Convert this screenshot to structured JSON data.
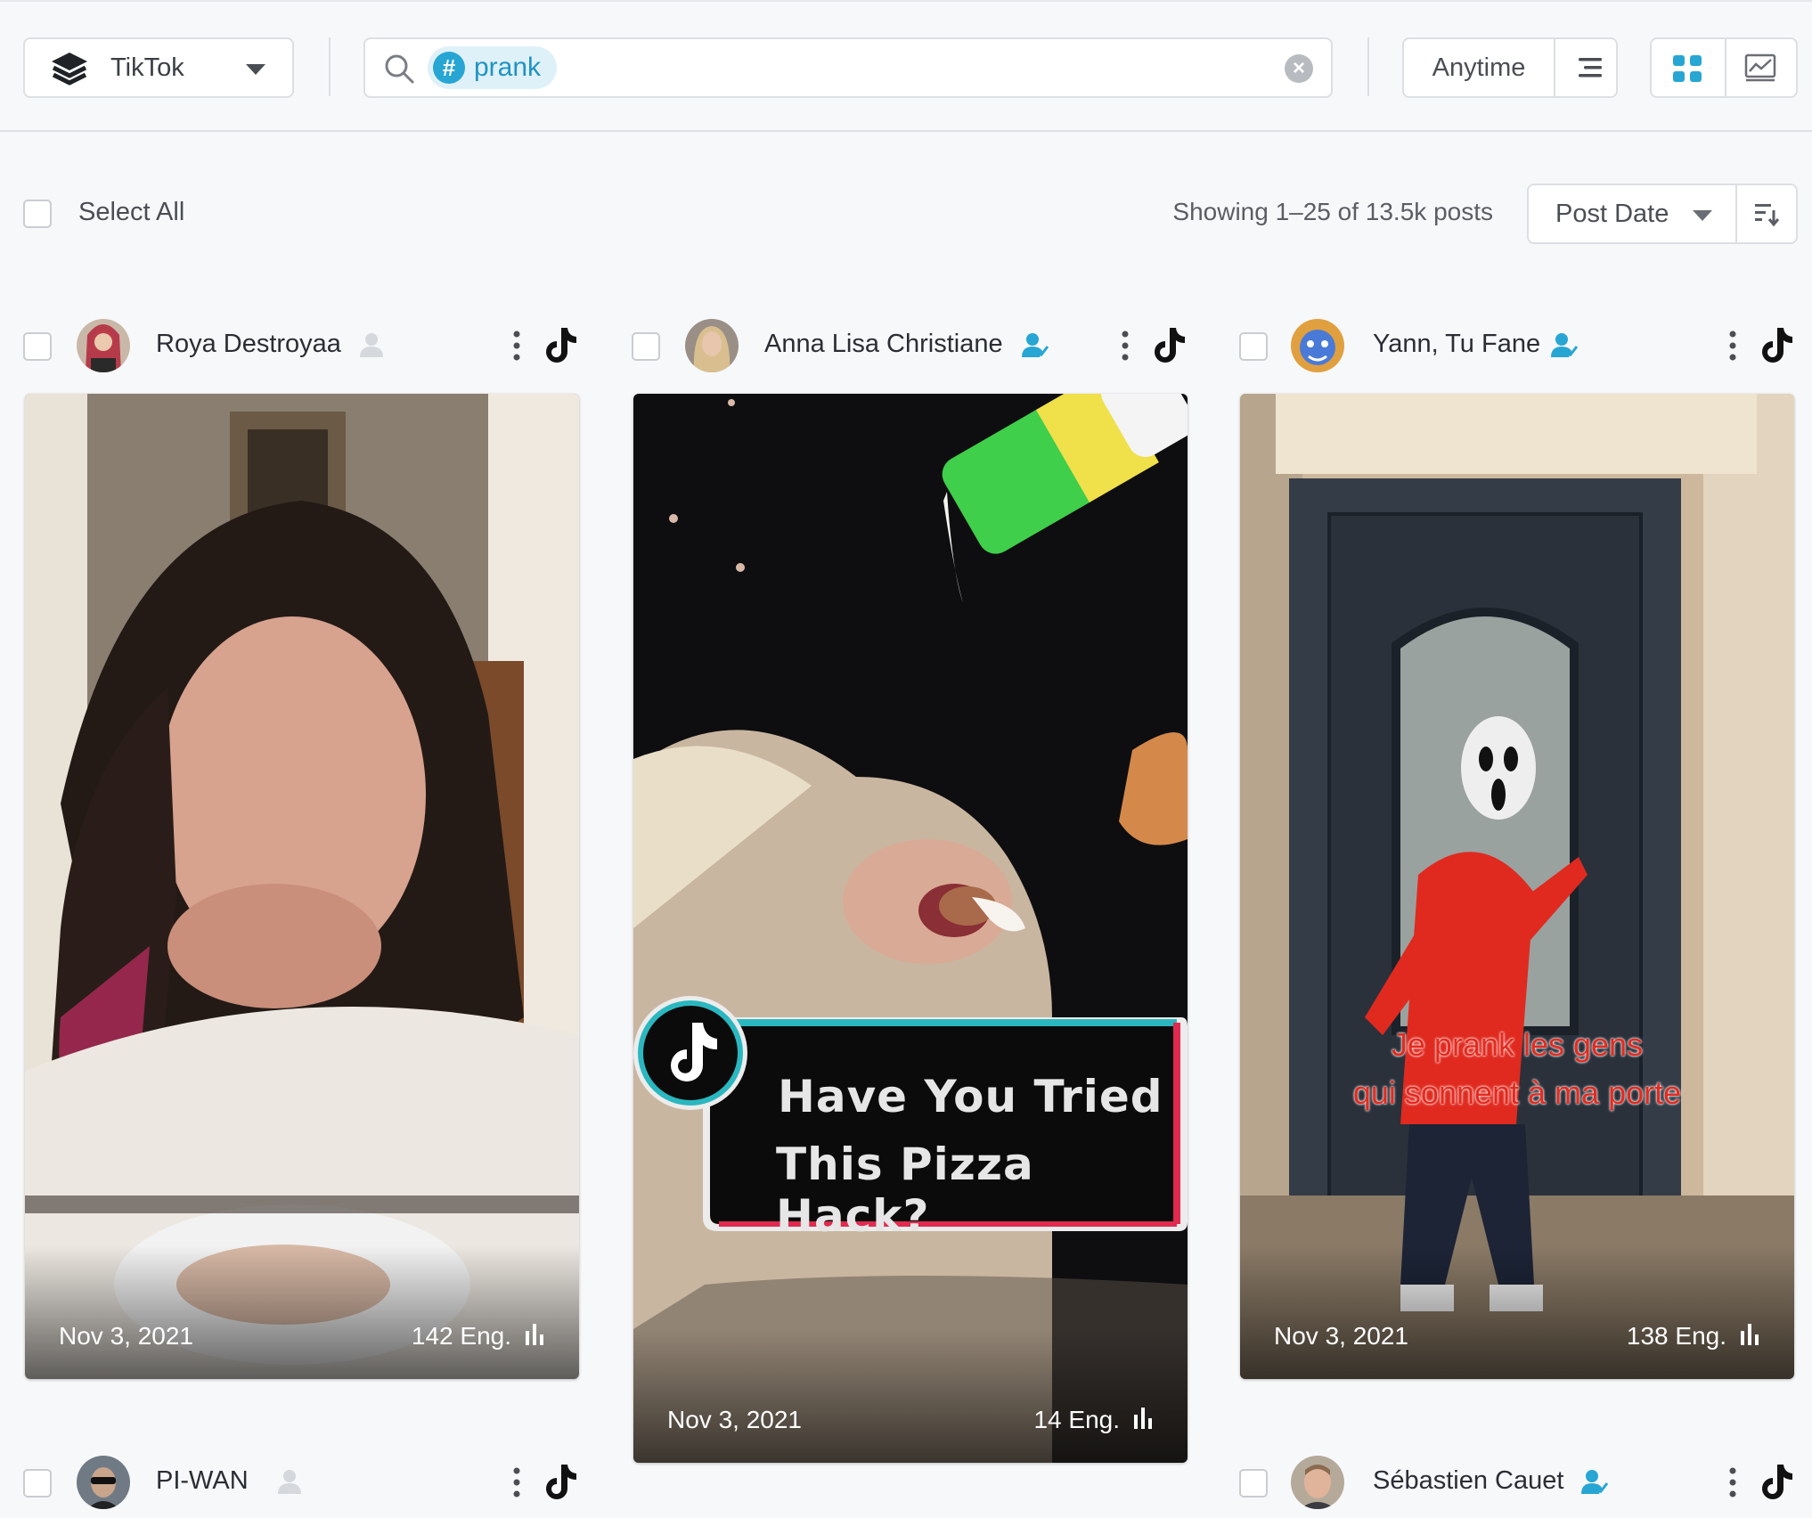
{
  "toolbar": {
    "platform": "TikTok",
    "search_tag": "prank",
    "time_filter": "Anytime"
  },
  "list": {
    "select_all": "Select All",
    "showing": "Showing 1–25 of 13.5k posts",
    "sort_label": "Post Date"
  },
  "posts": [
    {
      "author": "Roya Destroyaa",
      "date": "Nov 3, 2021",
      "engagement": "142 Eng.",
      "overlay": ""
    },
    {
      "author": "Anna Lisa Christiane",
      "date": "Nov 3, 2021",
      "engagement": "14 Eng.",
      "overlay_line1": "Have You Tried",
      "overlay_line2": "This Pizza Hack?"
    },
    {
      "author": "Yann, Tu Fane",
      "date": "Nov 3, 2021",
      "engagement": "138 Eng.",
      "overlay_line1": "Je prank les gens",
      "overlay_line2": "qui sonnent à ma porte"
    },
    {
      "author": "PI-WAN"
    },
    {
      "author": "Sébastien Cauet"
    }
  ],
  "colors": {
    "accent": "#27a6d4",
    "chip_bg": "#dff1f8",
    "border": "#dcdfe3",
    "page_bg": "#f7f8fa"
  }
}
